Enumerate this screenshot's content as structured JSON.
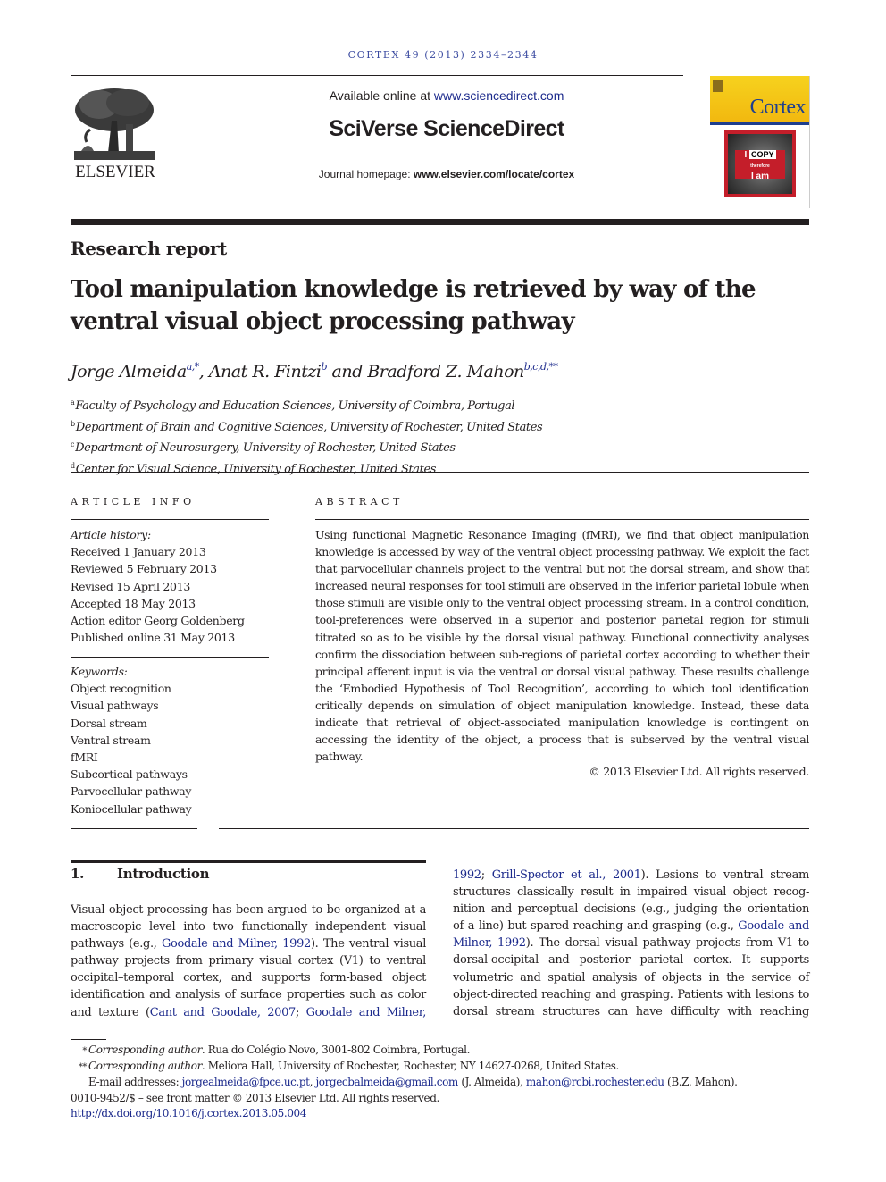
{
  "header": {
    "journal_ref": "CORTEX 49 (2013) 2334–2344",
    "publisher_logo_text": "ELSEVIER",
    "available_prefix": "Available online at ",
    "available_link": "www.sciencedirect.com",
    "platform_name": "SciVerse ScienceDirect",
    "homepage_prefix": "Journal homepage: ",
    "homepage_link": "www.elsevier.com/locate/cortex",
    "cover": {
      "journal_name": "Cortex",
      "image_text_line1": "I",
      "image_text_copy": "COPY",
      "image_text_small": "therefore",
      "image_text_line3": "I am",
      "brand_color": "#1e3f8f",
      "cover_yellow": "#f2b80f",
      "image_red": "#c41e2a"
    }
  },
  "article": {
    "type": "Research report",
    "title_line1": "Tool manipulation knowledge is retrieved by way of the",
    "title_line2": "ventral visual object processing pathway",
    "authors": [
      {
        "name": "Jorge Almeida",
        "sup": "a,*",
        "sep": ", "
      },
      {
        "name": "Anat R. Fintzi",
        "sup": "b",
        "sep": " and "
      },
      {
        "name": "Bradford Z. Mahon",
        "sup": "b,c,d,**",
        "sep": ""
      }
    ],
    "affiliations": [
      {
        "mark": "a",
        "text": "Faculty of Psychology and Education Sciences, University of Coimbra, Portugal"
      },
      {
        "mark": "b",
        "text": "Department of Brain and Cognitive Sciences, University of Rochester, United States"
      },
      {
        "mark": "c",
        "text": "Department of Neurosurgery, University of Rochester, United States"
      },
      {
        "mark": "d",
        "text": "Center for Visual Science, University of Rochester, United States"
      }
    ]
  },
  "article_info": {
    "heading": "ARTICLE INFO",
    "history_label": "Article history:",
    "history": [
      "Received 1 January 2013",
      "Reviewed 5 February 2013",
      "Revised 15 April 2013",
      "Accepted 18 May 2013",
      "Action editor Georg Goldenberg",
      "Published online 31 May 2013"
    ],
    "keywords_label": "Keywords:",
    "keywords": [
      "Object recognition",
      "Visual pathways",
      "Dorsal stream",
      "Ventral stream",
      "fMRI",
      "Subcortical pathways",
      "Parvocellular pathway",
      "Koniocellular pathway"
    ]
  },
  "abstract": {
    "heading": "ABSTRACT",
    "text": "Using functional Magnetic Resonance Imaging (fMRI), we find that object manipulation knowledge is accessed by way of the ventral object processing pathway. We exploit the fact that parvocellular channels project to the ventral but not the dorsal stream, and show that increased neural responses for tool stimuli are observed in the inferior parietal lobule when those stimuli are visible only to the ventral object processing stream. In a control condition, tool-preferences were observed in a superior and posterior parietal region for stimuli titrated so as to be visible by the dorsal visual pathway. Functional connectivity analyses confirm the dissociation between sub-regions of parietal cortex according to whether their principal afferent input is via the ventral or dorsal visual pathway. These results challenge the ‘Embodied Hypothesis of Tool Recognition’, according to which tool identification critically depends on simulation of object manipulation knowledge. Instead, these data indicate that retrieval of object-associated manipulation knowledge is contin­gent on accessing the identity of the object, a process that is subserved by the ventral visual pathway.",
    "copyright": "© 2013 Elsevier Ltd. All rights reserved."
  },
  "introduction": {
    "number": "1.",
    "heading": "Introduction",
    "left_lines": [
      [
        {
          "t": "Visual object processing has been argued to be organized at a"
        }
      ],
      [
        {
          "t": "macroscopic level into two functionally independent visual"
        }
      ],
      [
        {
          "t": "pathways (e.g., "
        },
        {
          "t": "Goodale and Milner, 1992",
          "link": true
        },
        {
          "t": "). The ventral visual"
        }
      ],
      [
        {
          "t": "pathway projects from primary visual cortex (V1) to ventral"
        }
      ],
      [
        {
          "t": "occipital–temporal cortex, and supports form-based object"
        }
      ],
      [
        {
          "t": "identification and analysis of surface properties such as color"
        }
      ],
      [
        {
          "t": "and texture ("
        },
        {
          "t": "Cant and Goodale, 2007",
          "link": true
        },
        {
          "t": "; "
        },
        {
          "t": "Goodale and Milner,",
          "link": true
        }
      ]
    ],
    "right_lines": [
      [
        {
          "t": "1992",
          "link": true
        },
        {
          "t": "; "
        },
        {
          "t": "Grill-Spector et al., 2001",
          "link": true
        },
        {
          "t": "). Lesions to ventral stream"
        }
      ],
      [
        {
          "t": "structures classically result in impaired visual object recog-"
        }
      ],
      [
        {
          "t": "nition and perceptual decisions (e.g., judging the orientation"
        }
      ],
      [
        {
          "t": "of a line) but spared reaching and grasping (e.g., "
        },
        {
          "t": "Goodale and",
          "link": true
        }
      ],
      [
        {
          "t": "Milner, 1992",
          "link": true
        },
        {
          "t": "). The dorsal visual pathway projects from V1 to"
        }
      ],
      [
        {
          "t": "dorsal-occipital and posterior parietal cortex. It supports"
        }
      ],
      [
        {
          "t": "volumetric and spatial analysis of objects in the service of"
        }
      ],
      [
        {
          "t": "object-directed reaching and grasping. Patients with lesions to"
        }
      ],
      [
        {
          "t": "dorsal stream structures can have difficulty with reaching"
        }
      ]
    ]
  },
  "footnotes": {
    "fn1_mark": "*",
    "fn1_label": "Corresponding author",
    "fn1_text": ". Rua do Colégio Novo, 3001-802 Coimbra, Portugal.",
    "fn2_mark": "**",
    "fn2_label": "Corresponding author",
    "fn2_text": ". Meliora Hall, University of Rochester, Rochester, NY 14627-0268, United States.",
    "email_prefix": "E-mail addresses: ",
    "email1": "jorgealmeida@fpce.uc.pt",
    "email_sep": ", ",
    "email2": "jorgecbalmeida@gmail.com",
    "email2_owner": " (J. Almeida), ",
    "email3": "mahon@rcbi.rochester.edu",
    "email3_owner": " (B.Z. Mahon).",
    "issn_line": "0010-9452/$ – see front matter © 2013 Elsevier Ltd. All rights reserved.",
    "doi": "http://dx.doi.org/10.1016/j.cortex.2013.05.004"
  },
  "colors": {
    "link": "#1c2a8c",
    "text": "#231f20",
    "journal_ref": "#3a4aa0"
  }
}
